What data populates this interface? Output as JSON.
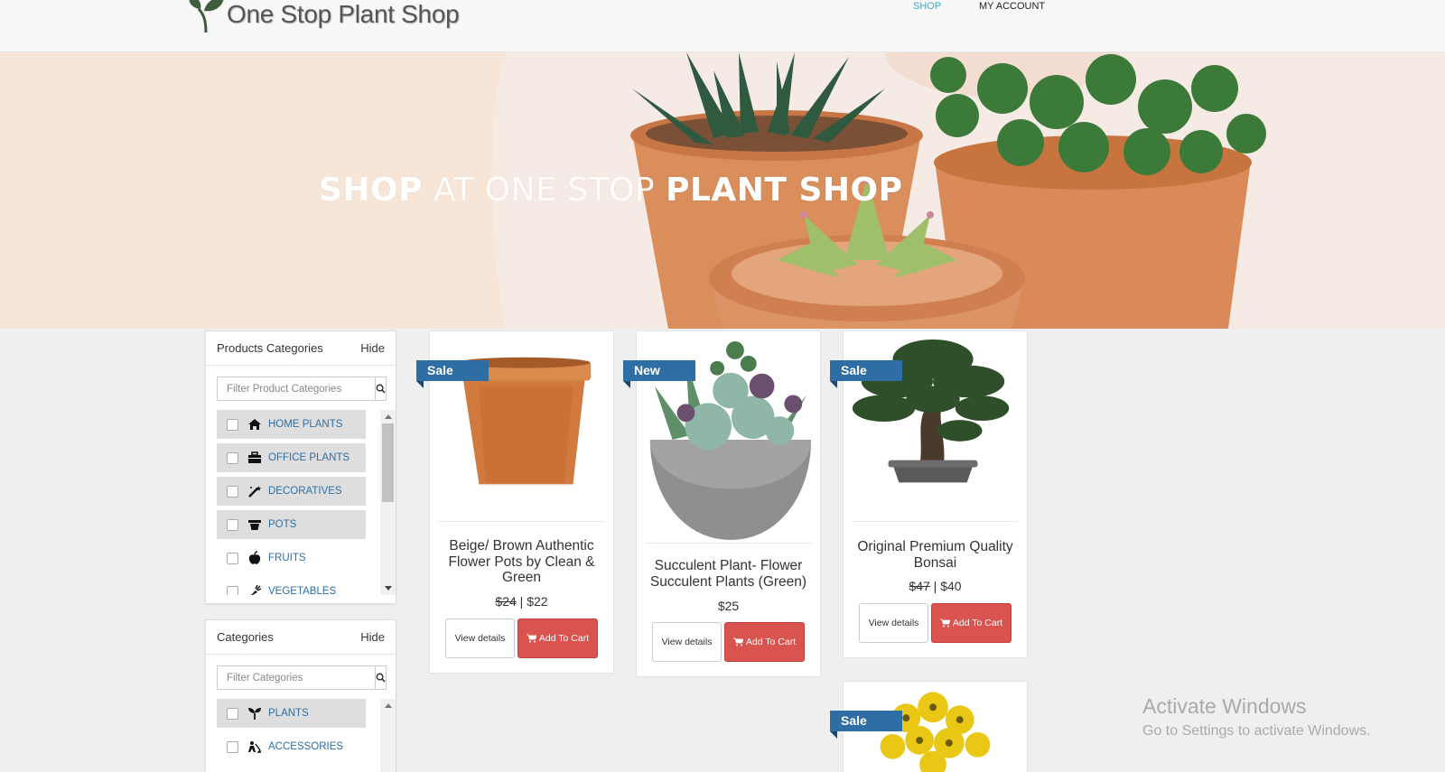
{
  "header": {
    "brand": "One Stop Plant Shop",
    "nav": [
      {
        "label": "SHOP"
      },
      {
        "label": "MY ACCOUNT"
      }
    ]
  },
  "hero": {
    "title_strong": "SHOP",
    "title_light": "AT ONE STOP",
    "title_strong2": "PLANT SHOP"
  },
  "product_categories": {
    "title": "Products Categories",
    "hide_label": "Hide",
    "filter_placeholder": "Filter Product Categories",
    "items": [
      {
        "label": "HOME PLANTS",
        "icon": "home-icon"
      },
      {
        "label": "OFFICE PLANTS",
        "icon": "briefcase-icon"
      },
      {
        "label": "DECORATIVES",
        "icon": "magic-wand-icon"
      },
      {
        "label": "POTS",
        "icon": "pot-icon"
      },
      {
        "label": "FRUITS",
        "icon": "apple-icon"
      },
      {
        "label": "VEGETABLES",
        "icon": "carrot-icon"
      }
    ]
  },
  "categories": {
    "title": "Categories",
    "hide_label": "Hide",
    "filter_placeholder": "Filter Categories",
    "items": [
      {
        "label": "PLANTS",
        "icon": "seedling-icon"
      },
      {
        "label": "ACCESSORIES",
        "icon": "gardener-icon"
      }
    ]
  },
  "products": [
    {
      "badge": "Sale",
      "name": "Beige/ Brown Authentic Flower Pots by Clean & Green",
      "old_price": "$24",
      "price": "$22",
      "details": "View details",
      "cart": "Add To Cart"
    },
    {
      "badge": "New",
      "name": "Succulent Plant- Flower Succulent Plants (Green)",
      "price": "$25",
      "details": "View details",
      "cart": "Add To Cart"
    },
    {
      "badge": "Sale",
      "name": "Original Premium Quality Bonsai",
      "old_price": "$47",
      "price": "$40",
      "details": "View details",
      "cart": "Add To Cart"
    },
    {
      "badge": "Sale"
    }
  ],
  "watermark": {
    "line1": "Activate Windows",
    "line2": "Go to Settings to activate Windows."
  },
  "colors": {
    "accent": "#2f6ea5",
    "cart": "#d9534f",
    "nav_active": "#39a8c5"
  }
}
